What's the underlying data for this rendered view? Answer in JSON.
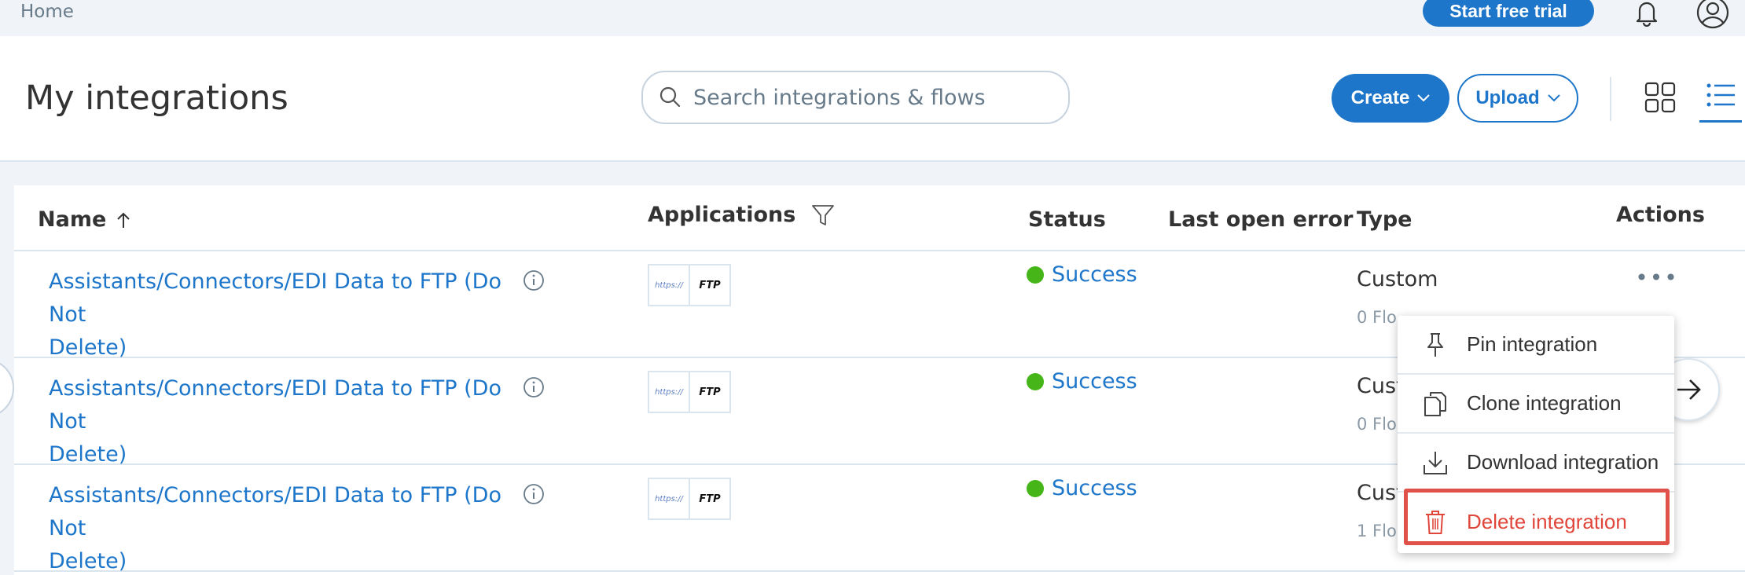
{
  "topbar": {
    "breadcrumb": "Home",
    "trial_label": "Start free trial",
    "icons": [
      "bell-icon",
      "account-icon"
    ]
  },
  "header": {
    "title": "My integrations",
    "search": {
      "placeholder": "Search integrations & flows",
      "value": ""
    },
    "create_label": "Create",
    "upload_label": "Upload",
    "view_modes": [
      "tile-view-icon",
      "list-view-icon"
    ],
    "active_view": "list"
  },
  "table": {
    "columns": {
      "name": "Name",
      "applications": "Applications",
      "status": "Status",
      "last_open_error": "Last open error",
      "type": "Type",
      "actions": "Actions"
    },
    "sort": {
      "column": "Name",
      "direction": "ascending"
    },
    "rows": [
      {
        "name_line1": "Assistants/Connectors/EDI Data to FTP (Do Not",
        "name_line2": "Delete)",
        "apps": [
          "https://",
          "FTP"
        ],
        "status": "Success",
        "type": "Custom",
        "flows": "0 Flo"
      },
      {
        "name_line1": "Assistants/Connectors/EDI Data to FTP (Do Not",
        "name_line2": "Delete)",
        "apps": [
          "https://",
          "FTP"
        ],
        "status": "Success",
        "type": "Cust",
        "flows": "0 Flo"
      },
      {
        "name_line1": "Assistants/Connectors/EDI Data to FTP (Do Not",
        "name_line2": "Delete)",
        "apps": [
          "https://",
          "FTP"
        ],
        "status": "Success",
        "type": "Cust",
        "flows": "1 Flo"
      }
    ]
  },
  "actions_menu": {
    "items": [
      {
        "label": "Pin integration",
        "icon": "pin-icon"
      },
      {
        "label": "Clone integration",
        "icon": "clone-icon"
      },
      {
        "label": "Download integration",
        "icon": "download-icon"
      },
      {
        "label": "Delete integration",
        "icon": "trash-icon",
        "highlighted": true
      }
    ]
  },
  "colors": {
    "accent": "#1d76c9",
    "success": "#45b518",
    "danger": "#e0463a",
    "highlight_border": "#e05249"
  }
}
